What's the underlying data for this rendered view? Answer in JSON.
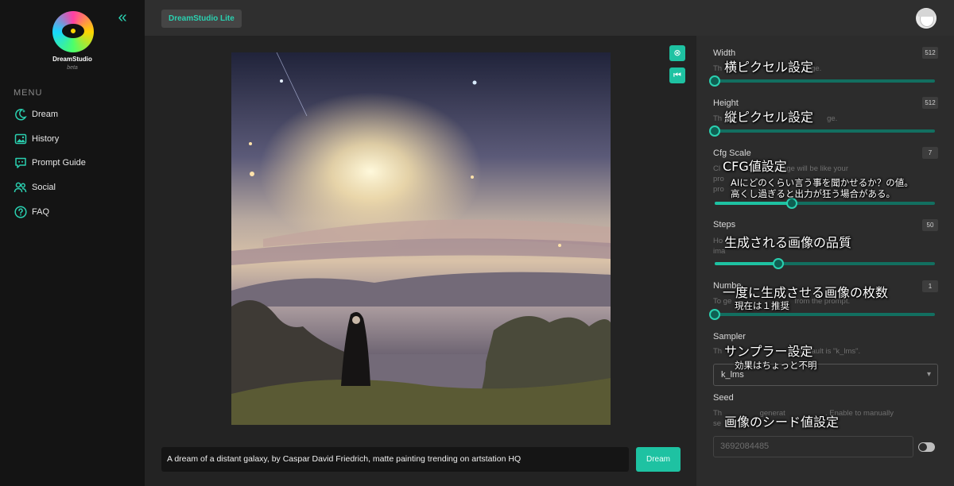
{
  "app": {
    "brand": "DreamStudio",
    "brand_sub": "beta",
    "badge": "DreamStudio Lite"
  },
  "sidebar": {
    "menu_heading": "MENU",
    "items": [
      {
        "label": "Dream",
        "icon": "moon-sparkle-icon"
      },
      {
        "label": "History",
        "icon": "image-gallery-icon"
      },
      {
        "label": "Prompt Guide",
        "icon": "chat-quote-icon"
      },
      {
        "label": "Social",
        "icon": "people-icon"
      },
      {
        "label": "FAQ",
        "icon": "question-circle-icon"
      }
    ]
  },
  "prompt": {
    "value": "A dream of a distant galaxy, by Caspar David Friedrich, matte painting trending on artstation HQ",
    "dream_label": "Dream"
  },
  "settings": {
    "width": {
      "label": "Width",
      "value": "512",
      "desc_left": "Th",
      "desc_right": "ge.",
      "slider_fraction": 0.0
    },
    "height": {
      "label": "Height",
      "value": "512",
      "desc_left": "Th",
      "desc_right": "ge.",
      "slider_fraction": 0.0
    },
    "cfg": {
      "label": "Cfg Scale",
      "value": "7",
      "desc_line1": "Cl          much the image will be like your",
      "desc_line2": "pro",
      "desc_line3": "pro",
      "slider_fraction": 0.35
    },
    "steps": {
      "label": "Steps",
      "value": "50",
      "desc_line1": "Ho                                        ing) your",
      "desc_line2": "ima",
      "slider_fraction": 0.29
    },
    "number": {
      "label": "Numbe",
      "value": "1",
      "desc_line1": "To ge                              from the prompt.",
      "slider_fraction": 0.0
    },
    "sampler": {
      "label": "Sampler",
      "desc": "Th                                   . Default is \"k_lms\".",
      "selected": "k_lms"
    },
    "seed": {
      "label": "Seed",
      "desc_line1": "Th                  generat                   . Enable to manually",
      "desc_line2": "se",
      "value": "3692084485"
    }
  },
  "annotations": {
    "width": "横ピクセル設定",
    "height": "縦ピクセル設定",
    "cfg_title": "CFG値設定",
    "cfg_line1": "AIにどのくらい言う事を聞かせるか？の値。",
    "cfg_line2": "高くし過ぎると出力が狂う場合がある。",
    "steps": "生成される画像の品質",
    "number": "一度に生成させる画像の枚数",
    "number_sub": "現在は１推奨",
    "sampler": "サンプラー設定",
    "sampler_sub": "効果はちょっと不明",
    "seed": "画像のシード値設定"
  },
  "colors": {
    "accent": "#1ec2a2",
    "sidebar_bg": "#141414",
    "panel_bg": "#2c2c2c"
  }
}
